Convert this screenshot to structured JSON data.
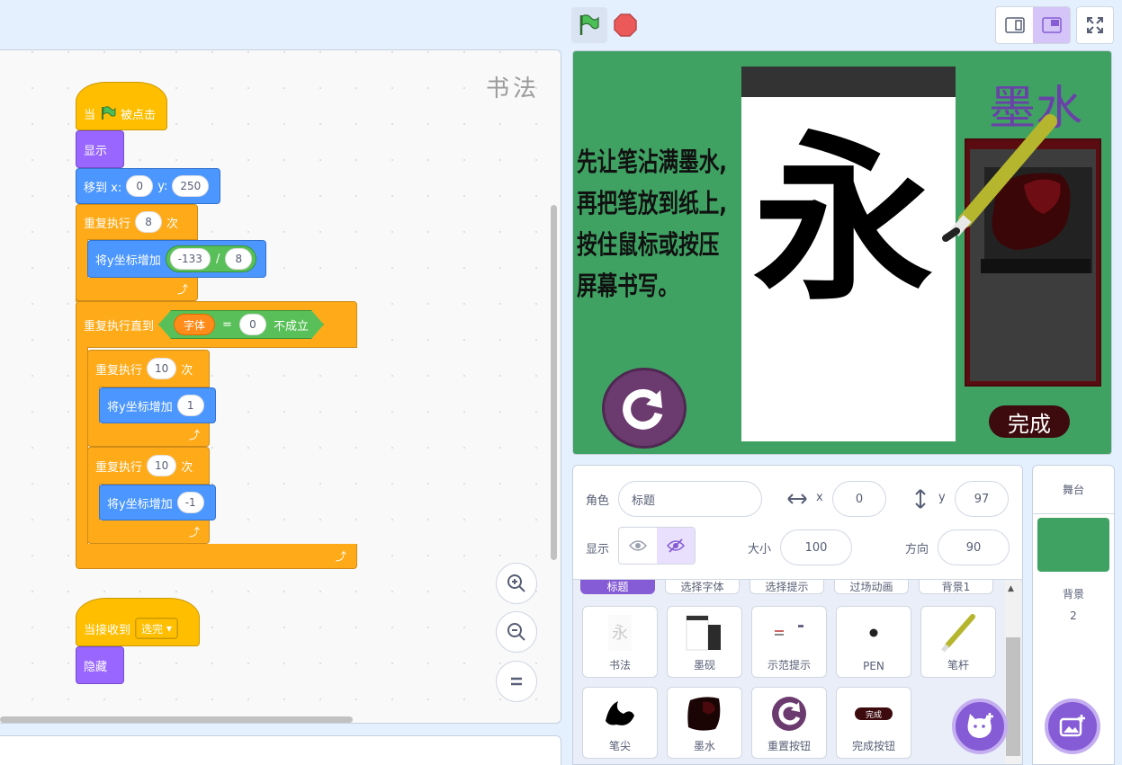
{
  "code": {
    "watermark": "书法",
    "script1": {
      "hat_prefix": "当",
      "hat_suffix": "被点击",
      "show": "显示",
      "goto_label": "移到 x:",
      "goto_x": "0",
      "goto_y_label": "y:",
      "goto_y": "250",
      "repeat1_label": "重复执行",
      "repeat1_count": "8",
      "repeat1_unit": "次",
      "changey1_label": "将y坐标增加",
      "changey1_a": "-133",
      "changey1_op": "/",
      "changey1_b": "8",
      "until_label": "重复执行直到",
      "until_var": "字体",
      "until_eq": "=",
      "until_val": "0",
      "until_not": "不成立",
      "repeat2_label": "重复执行",
      "repeat2_count": "10",
      "repeat2_unit": "次",
      "changey2_label": "将y坐标增加",
      "changey2_val": "1",
      "repeat3_label": "重复执行",
      "repeat3_count": "10",
      "repeat3_unit": "次",
      "changey3_label": "将y坐标增加",
      "changey3_val": "-1"
    },
    "script2": {
      "hat_label": "当接收到",
      "hat_msg": "选完",
      "hide": "隐藏"
    }
  },
  "stage": {
    "instructions": [
      "先让笔沾满墨水,",
      "再把笔放到纸上,",
      "按住鼠标或按压",
      "屏幕书写。"
    ],
    "character": "永",
    "ink_label": "墨水",
    "done_label": "完成"
  },
  "sprite_info": {
    "sprite_label": "角色",
    "sprite_name": "标题",
    "x_label": "x",
    "x": "0",
    "y_label": "y",
    "y": "97",
    "show_label": "显示",
    "size_label": "大小",
    "size": "100",
    "direction_label": "方向",
    "direction": "90"
  },
  "sprite_tabs": [
    "标题",
    "选择字体",
    "选择提示",
    "过场动画",
    "背景1"
  ],
  "sprites": [
    {
      "name": "书法"
    },
    {
      "name": "墨砚"
    },
    {
      "name": "示范提示"
    },
    {
      "name": "PEN"
    },
    {
      "name": "笔杆"
    },
    {
      "name": "笔尖"
    },
    {
      "name": "墨水"
    },
    {
      "name": "重置按钮"
    },
    {
      "name": "完成按钮"
    }
  ],
  "stage_pane": {
    "header": "舞台",
    "backdrop_label": "背景",
    "backdrop_count": "2"
  },
  "colors": {
    "stage_green": "#3fa263",
    "accent": "#855cd6"
  }
}
